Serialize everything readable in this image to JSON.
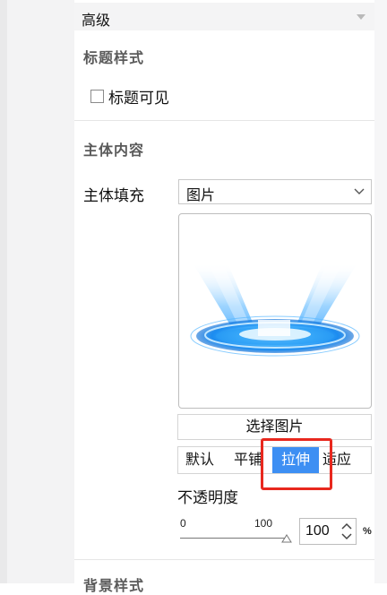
{
  "panel": {
    "advanced": {
      "title": "高级"
    },
    "title_style": {
      "heading": "标题样式",
      "show_title_checkbox": {
        "label": "标题可见",
        "checked": false
      }
    },
    "body_content": {
      "heading": "主体内容",
      "fill_label": "主体填充",
      "fill_select_value": "图片",
      "choose_image_button": "选择图片",
      "fit_modes": [
        "默认",
        "平铺",
        "拉伸",
        "适应"
      ],
      "fit_modes_visible": [
        "默认",
        "平铺",
        "拉伸",
        "适应"
      ],
      "active_fit_mode": "拉伸",
      "opacity": {
        "label": "不透明度",
        "slider_min": "0",
        "slider_max": "100",
        "value": "100",
        "unit": "%",
        "slider_level": 1.0
      }
    },
    "background_style": {
      "heading": "背景样式"
    }
  },
  "colors": {
    "accent": "#3d8ff3",
    "highlight_border": "#e8281e"
  },
  "icons": {
    "header_caret": "caret-down-icon",
    "select_chevron": "chevron-down-icon",
    "slider_thumb": "triangle-thumb-icon",
    "spinner": "spinner-arrows-icon"
  }
}
